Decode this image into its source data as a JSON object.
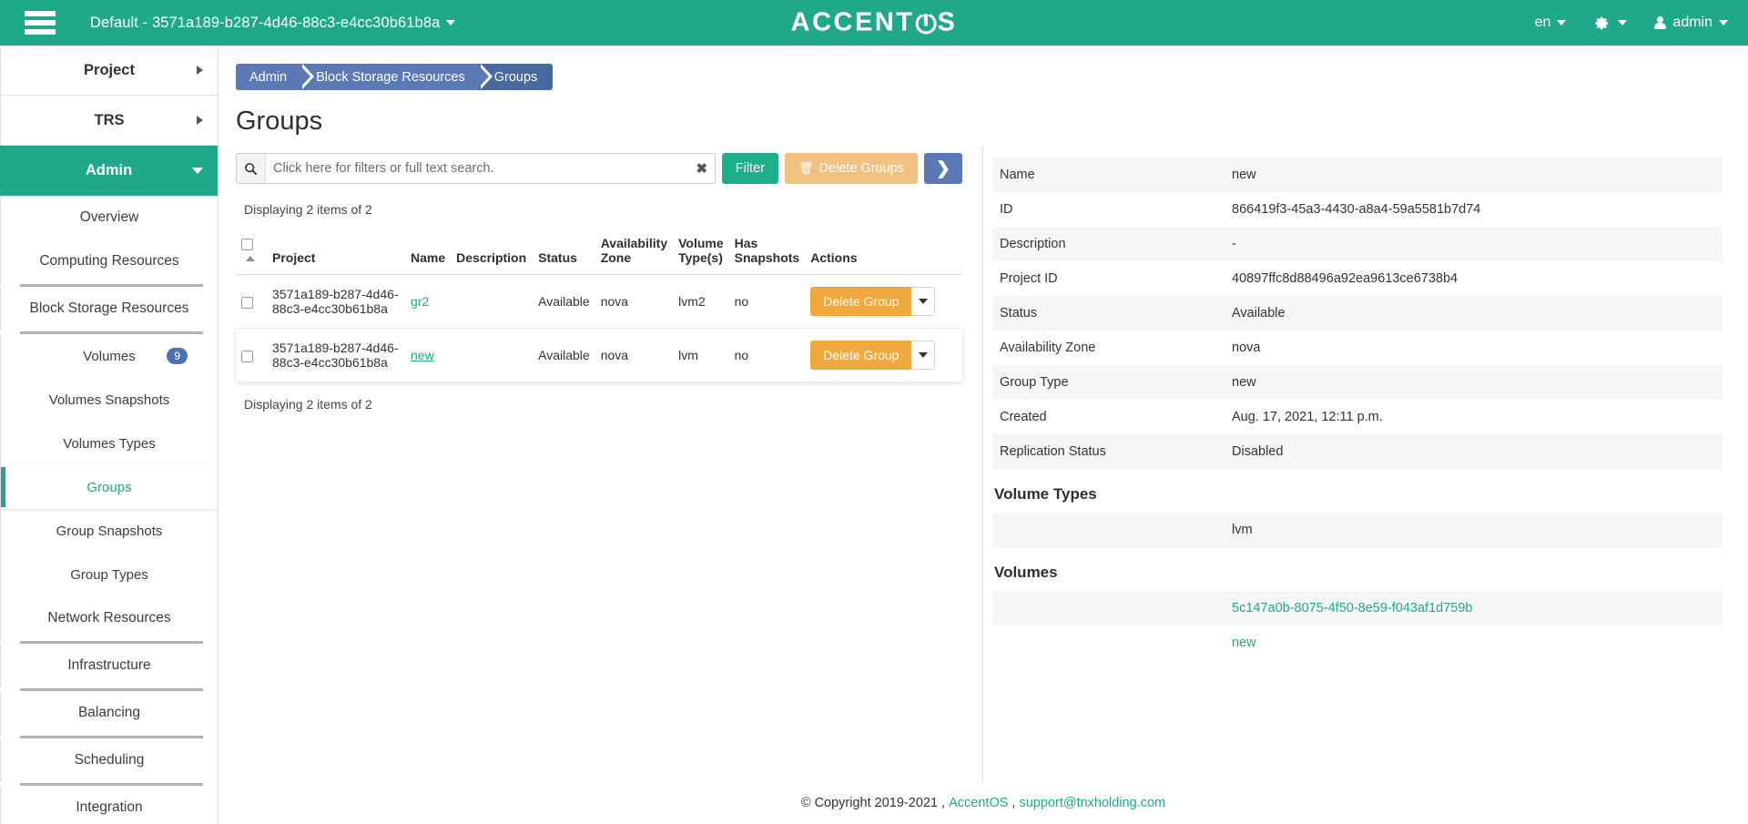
{
  "topbar": {
    "menu_icon": "hamburger-icon",
    "tenant": "Default - 3571a189-b287-4d46-88c3-e4cc30b61b8a",
    "brand_left": "ACCENT",
    "brand_right": "S",
    "brand_full": "ACCENTOS",
    "language": "en",
    "settings_icon": "gear-icon",
    "user": "admin"
  },
  "sidebar": {
    "panels": [
      {
        "label": "Project",
        "type": "panel",
        "active": false
      },
      {
        "label": "TRS",
        "type": "panel",
        "active": false
      },
      {
        "label": "Admin",
        "type": "panel",
        "active": true
      }
    ],
    "items": [
      {
        "label": "Overview",
        "active": false,
        "badge": ""
      },
      {
        "label": "Computing Resources",
        "active": false,
        "badge": ""
      },
      {
        "label": "Block Storage Resources",
        "active": false,
        "badge": ""
      },
      {
        "label": "Volumes",
        "active": false,
        "badge": "9"
      },
      {
        "label": "Volumes Snapshots",
        "active": false,
        "badge": ""
      },
      {
        "label": "Volumes Types",
        "active": false,
        "badge": ""
      },
      {
        "label": "Groups",
        "active": true,
        "badge": ""
      },
      {
        "label": "Group Snapshots",
        "active": false,
        "badge": ""
      },
      {
        "label": "Group Types",
        "active": false,
        "badge": ""
      },
      {
        "label": "Network Resources",
        "active": false,
        "badge": ""
      },
      {
        "label": "Infrastructure",
        "active": false,
        "badge": ""
      },
      {
        "label": "Balancing",
        "active": false,
        "badge": ""
      },
      {
        "label": "Scheduling",
        "active": false,
        "badge": ""
      },
      {
        "label": "Integration",
        "active": false,
        "badge": ""
      }
    ]
  },
  "breadcrumb": [
    {
      "label": "Admin"
    },
    {
      "label": "Block Storage Resources"
    },
    {
      "label": "Groups"
    }
  ],
  "page": {
    "title": "Groups"
  },
  "toolbar": {
    "search_placeholder": "Click here for filters or full text search.",
    "search_value": "",
    "search_icon": "search-icon",
    "clear_icon": "✖",
    "filter_label": "Filter",
    "delete_groups_label": "Delete Groups",
    "delete_icon": "🗑",
    "next_label": "❯"
  },
  "table": {
    "displaying_top": "Displaying 2 items of 2",
    "displaying_bottom": "Displaying 2 items of 2",
    "headers": {
      "project": "Project",
      "name": "Name",
      "description": "Description",
      "status": "Status",
      "availability_zone": "Availability Zone",
      "volume_types": "Volume Type(s)",
      "has_snapshots": "Has Snapshots",
      "actions": "Actions"
    },
    "rows": [
      {
        "project": "3571a189-b287-4d46-88c3-e4cc30b61b8a",
        "name": "gr2",
        "description": "",
        "status": "Available",
        "availability_zone": "nova",
        "volume_types": "lvm2",
        "has_snapshots": "no",
        "action_label": "Delete Group",
        "hovered": false
      },
      {
        "project": "3571a189-b287-4d46-88c3-e4cc30b61b8a",
        "name": "new",
        "description": "",
        "status": "Available",
        "availability_zone": "nova",
        "volume_types": "lvm",
        "has_snapshots": "no",
        "action_label": "Delete Group",
        "hovered": true
      }
    ]
  },
  "detail": {
    "rows": [
      {
        "key": "Name",
        "value": "new"
      },
      {
        "key": "ID",
        "value": "866419f3-45a3-4430-a8a4-59a5581b7d74"
      },
      {
        "key": "Description",
        "value": "-"
      },
      {
        "key": "Project ID",
        "value": "40897ffc8d88496a92ea9613ce6738b4"
      },
      {
        "key": "Status",
        "value": "Available"
      },
      {
        "key": "Availability Zone",
        "value": "nova"
      },
      {
        "key": "Group Type",
        "value": "new"
      },
      {
        "key": "Created",
        "value": "Aug. 17, 2021, 12:11 p.m."
      },
      {
        "key": "Replication Status",
        "value": "Disabled"
      }
    ],
    "volume_types_heading": "Volume Types",
    "volume_types": [
      "lvm"
    ],
    "volumes_heading": "Volumes",
    "volumes": [
      "5c147a0b-8075-4f50-8e59-f043af1d759b",
      "new"
    ]
  },
  "footer": {
    "copyright": "© Copyright 2019-2021 ,",
    "brand_link": "AccentOS",
    "separator": ",",
    "email": "support@tnxholding.com"
  },
  "colors": {
    "accent": "#1fa98a",
    "breadcrumb": "#5b7ab5",
    "breadcrumb_active": "#47699f",
    "warning": "#f0a93c",
    "warning_disabled": "#f2c182",
    "badge": "#4a72b5"
  }
}
